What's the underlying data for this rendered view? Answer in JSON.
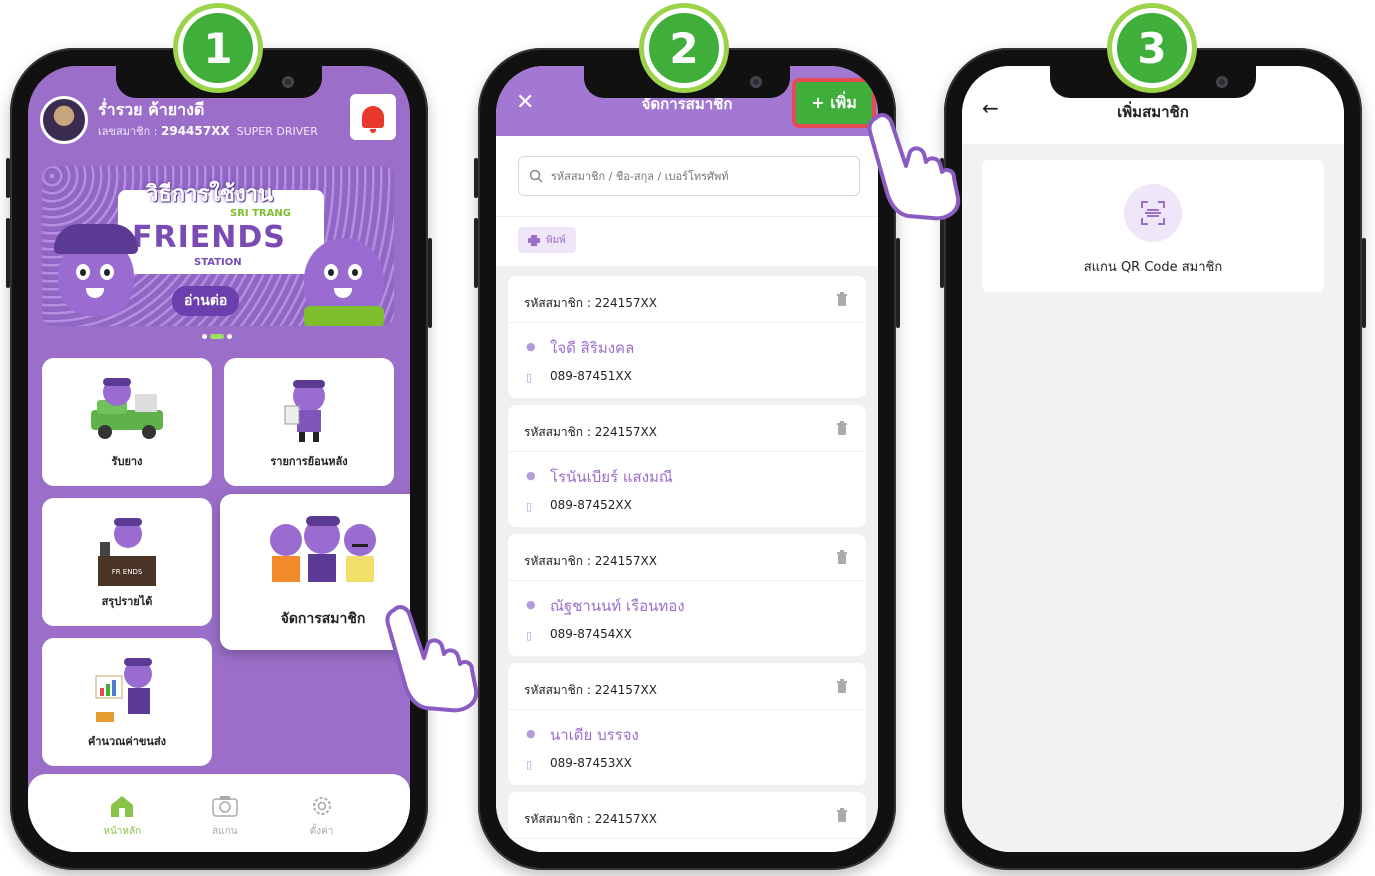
{
  "steps": [
    "1",
    "2",
    "3"
  ],
  "home": {
    "user_name": "ร่ำรวย ค้ายางดี",
    "member_label": "เลขสมาชิก : ",
    "member_id": "294457XX",
    "member_tier": "SUPER DRIVER",
    "banner": {
      "title": "วิธีการใช้งาน",
      "sub": "SRI TRANG",
      "logo": "FRIENDS",
      "station": "STATION",
      "read_more": "อ่านต่อ"
    },
    "tiles": [
      "รับยาง",
      "รายการย้อนหลัง",
      "สรุปรายได้",
      "จัดการสมาชิก",
      "คำนวณค่าขนส่ง"
    ],
    "tabs": [
      "หน้าหลัก",
      "สแกน",
      "ตั้งค่า"
    ]
  },
  "members": {
    "title": "จัดการสมาชิก",
    "add_label": "+ เพิ่ม",
    "search_placeholder": "รหัสสมาชิก / ชื่อ-สกุล / เบอร์โทรศัพท์",
    "print_label": "พิมพ์",
    "list": [
      {
        "code": "รหัสสมาชิก : 224157XX",
        "name": "ใจดี สิริมงคล",
        "phone": "089-87451XX"
      },
      {
        "code": "รหัสสมาชิก : 224157XX",
        "name": "โรนันเบียร์   แสงมณี",
        "phone": "089-87452XX"
      },
      {
        "code": "รหัสสมาชิก : 224157XX",
        "name": "ณัฐชานนท์   เรือนทอง",
        "phone": "089-87454XX"
      },
      {
        "code": "รหัสสมาชิก : 224157XX",
        "name": "นาเดีย   บรรจง",
        "phone": "089-87453XX"
      },
      {
        "code": "รหัสสมาชิก : 224157XX",
        "name": "",
        "phone": ""
      }
    ]
  },
  "add_member": {
    "title": "เพิ่มสมาชิก",
    "scan_label": "สแกน QR Code สมาชิก"
  },
  "colors": {
    "purple": "#9b6fc9",
    "green": "#3fae3a",
    "highlight_red": "#e84a55"
  }
}
